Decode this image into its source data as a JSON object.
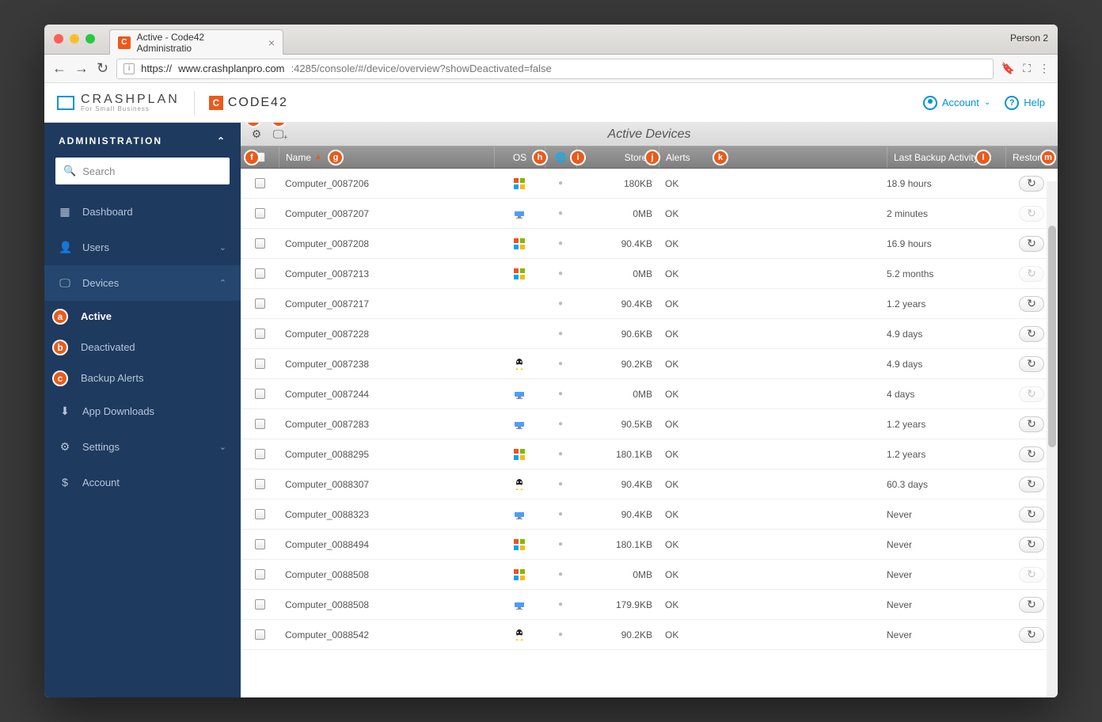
{
  "browser": {
    "tab_title": "Active - Code42 Administratio",
    "person": "Person 2",
    "url_proto": "https://",
    "url_host": "www.crashplanpro.com",
    "url_rest": ":4285/console/#/device/overview?showDeactivated=false"
  },
  "header": {
    "brand_main": "CRASHPLAN",
    "brand_sub": "For Small Business",
    "code42": "CODE42",
    "account": "Account",
    "help": "Help"
  },
  "sidebar": {
    "title": "ADMINISTRATION",
    "search_placeholder": "Search",
    "items": {
      "dashboard": "Dashboard",
      "users": "Users",
      "devices": "Devices",
      "active": "Active",
      "deactivated": "Deactivated",
      "backup_alerts": "Backup Alerts",
      "app_downloads": "App Downloads",
      "settings": "Settings",
      "account": "Account"
    }
  },
  "table": {
    "title": "Active Devices",
    "cols": {
      "name": "Name",
      "os": "OS",
      "stored": "Stored",
      "alerts": "Alerts",
      "backup": "Last Backup Activity",
      "restore": "Restore"
    },
    "rows": [
      {
        "name": "Computer_0087206",
        "os": "windows",
        "stored": "180KB",
        "alerts": "OK",
        "backup": "18.9 hours",
        "restore": true
      },
      {
        "name": "Computer_0087207",
        "os": "mac",
        "stored": "0MB",
        "alerts": "OK",
        "backup": "2 minutes",
        "restore": false
      },
      {
        "name": "Computer_0087208",
        "os": "windows",
        "stored": "90.4KB",
        "alerts": "OK",
        "backup": "16.9 hours",
        "restore": true
      },
      {
        "name": "Computer_0087213",
        "os": "windows",
        "stored": "0MB",
        "alerts": "OK",
        "backup": "5.2 months",
        "restore": false
      },
      {
        "name": "Computer_0087217",
        "os": "none",
        "stored": "90.4KB",
        "alerts": "OK",
        "backup": "1.2 years",
        "restore": true
      },
      {
        "name": "Computer_0087228",
        "os": "none",
        "stored": "90.6KB",
        "alerts": "OK",
        "backup": "4.9 days",
        "restore": true
      },
      {
        "name": "Computer_0087238",
        "os": "linux",
        "stored": "90.2KB",
        "alerts": "OK",
        "backup": "4.9 days",
        "restore": true
      },
      {
        "name": "Computer_0087244",
        "os": "mac",
        "stored": "0MB",
        "alerts": "OK",
        "backup": "4 days",
        "restore": false
      },
      {
        "name": "Computer_0087283",
        "os": "mac",
        "stored": "90.5KB",
        "alerts": "OK",
        "backup": "1.2 years",
        "restore": true
      },
      {
        "name": "Computer_0088295",
        "os": "windows",
        "stored": "180.1KB",
        "alerts": "OK",
        "backup": "1.2 years",
        "restore": true
      },
      {
        "name": "Computer_0088307",
        "os": "linux",
        "stored": "90.4KB",
        "alerts": "OK",
        "backup": "60.3 days",
        "restore": true
      },
      {
        "name": "Computer_0088323",
        "os": "mac",
        "stored": "90.4KB",
        "alerts": "OK",
        "backup": "Never",
        "restore": true
      },
      {
        "name": "Computer_0088494",
        "os": "windows",
        "stored": "180.1KB",
        "alerts": "OK",
        "backup": "Never",
        "restore": true
      },
      {
        "name": "Computer_0088508",
        "os": "windows",
        "stored": "0MB",
        "alerts": "OK",
        "backup": "Never",
        "restore": false
      },
      {
        "name": "Computer_0088508",
        "os": "mac",
        "stored": "179.9KB",
        "alerts": "OK",
        "backup": "Never",
        "restore": true
      },
      {
        "name": "Computer_0088542",
        "os": "linux",
        "stored": "90.2KB",
        "alerts": "OK",
        "backup": "Never",
        "restore": true
      }
    ]
  },
  "annotations": [
    "a",
    "b",
    "c",
    "d",
    "e",
    "f",
    "g",
    "h",
    "i",
    "j",
    "k",
    "l",
    "m"
  ]
}
